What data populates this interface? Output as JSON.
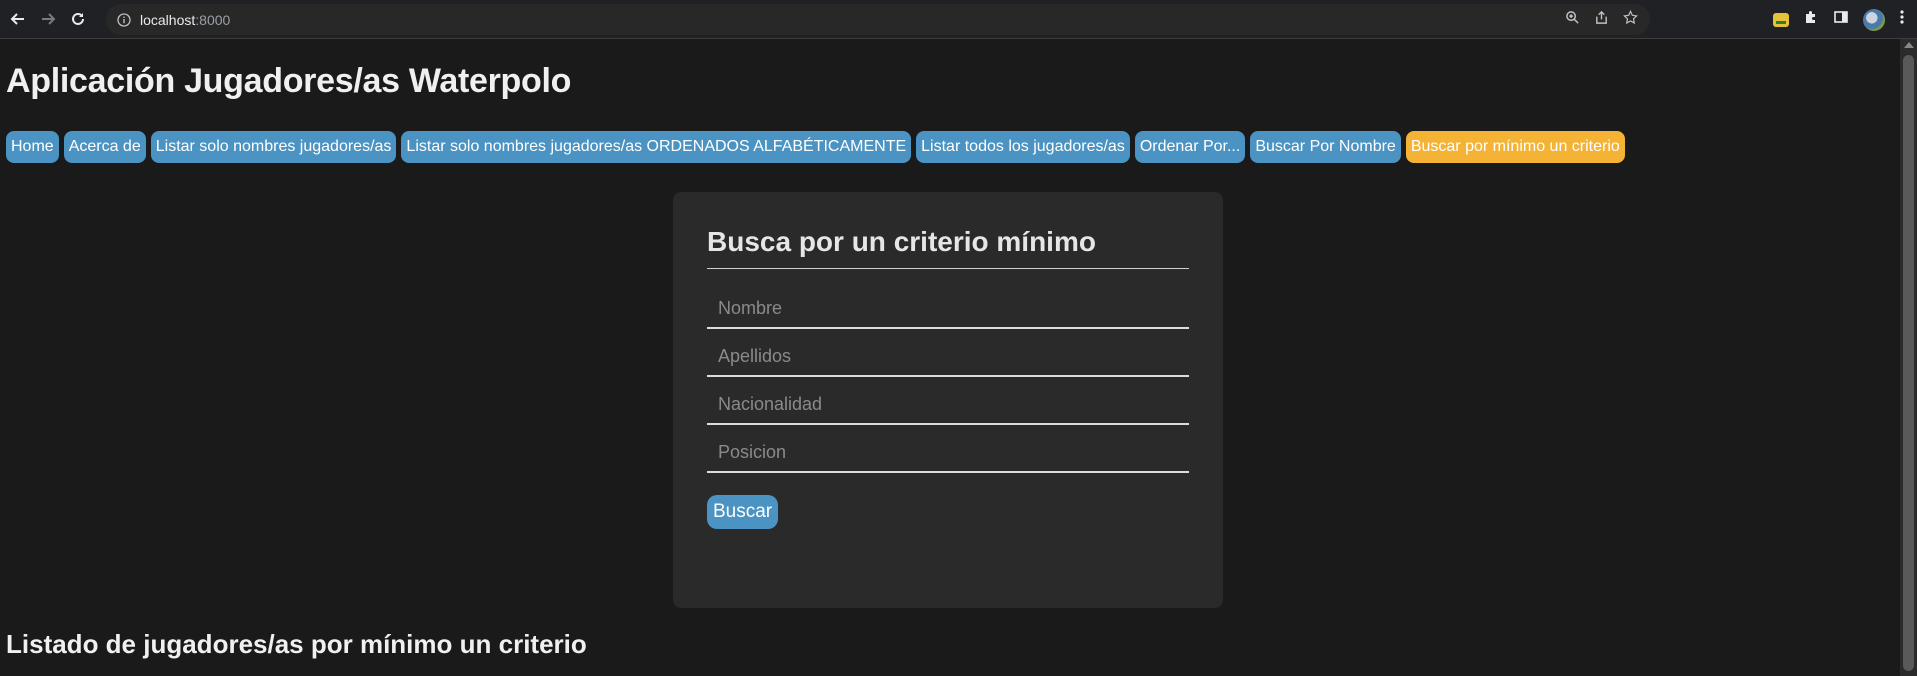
{
  "browser": {
    "url_host": "localhost",
    "url_port": ":8000"
  },
  "app": {
    "title": "Aplicación Jugadores/as Waterpolo"
  },
  "menu": {
    "items": [
      {
        "label": "Home"
      },
      {
        "label": "Acerca de"
      },
      {
        "label": "Listar solo nombres jugadores/as"
      },
      {
        "label": "Listar solo nombres jugadores/as ORDENADOS ALFABÉTICAMENTE"
      },
      {
        "label": "Listar todos los jugadores/as"
      },
      {
        "label": "Ordenar Por..."
      },
      {
        "label": "Buscar Por Nombre"
      },
      {
        "label": "Buscar por mínimo un criterio"
      }
    ],
    "active_color": "#f5b335",
    "button_color": "#4a93c2"
  },
  "form": {
    "title": "Busca por un criterio mínimo",
    "fields": [
      {
        "placeholder": "Nombre",
        "value": ""
      },
      {
        "placeholder": "Apellidos",
        "value": ""
      },
      {
        "placeholder": "Nacionalidad",
        "value": ""
      },
      {
        "placeholder": "Posicion",
        "value": ""
      }
    ],
    "submit_label": "Buscar"
  },
  "results": {
    "title": "Listado de jugadores/as por mínimo un criterio"
  }
}
